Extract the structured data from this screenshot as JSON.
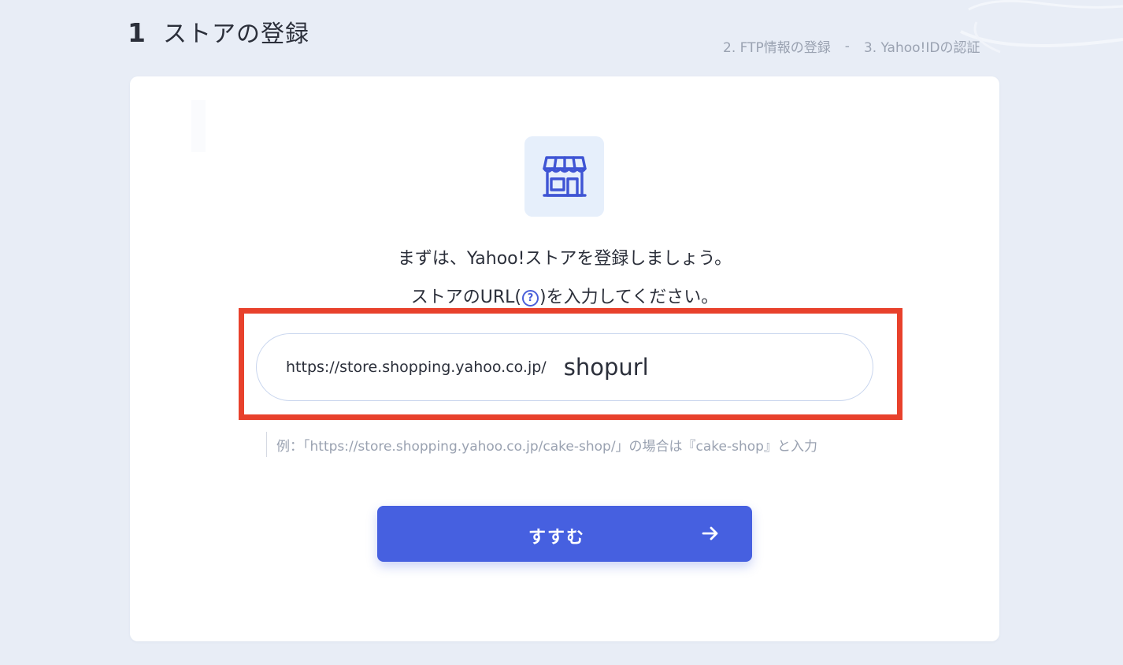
{
  "header": {
    "step_number": "1",
    "step_title": "ストアの登録"
  },
  "steps_nav": {
    "step2": "2. FTP情報の登録",
    "separator": "-",
    "step3": "3. Yahoo!IDの認証"
  },
  "card": {
    "icon": "store-icon",
    "intro_line1": "まずは、Yahoo!ストアを登録しましょう。",
    "intro_line2_before": "ストアのURL(",
    "help_glyph": "?",
    "intro_line2_after": ")を入力してください。",
    "url_prefix": "https://store.shopping.yahoo.co.jp/",
    "url_value": "shopurl",
    "example": "例：「https://store.shopping.yahoo.co.jp/cake-shop/」の場合は『cake-shop』と入力",
    "next_label": "すすむ",
    "next_icon": "arrow-right-icon"
  },
  "colors": {
    "background": "#e8edf6",
    "accent": "#4660e0",
    "highlight": "#e8412c"
  }
}
